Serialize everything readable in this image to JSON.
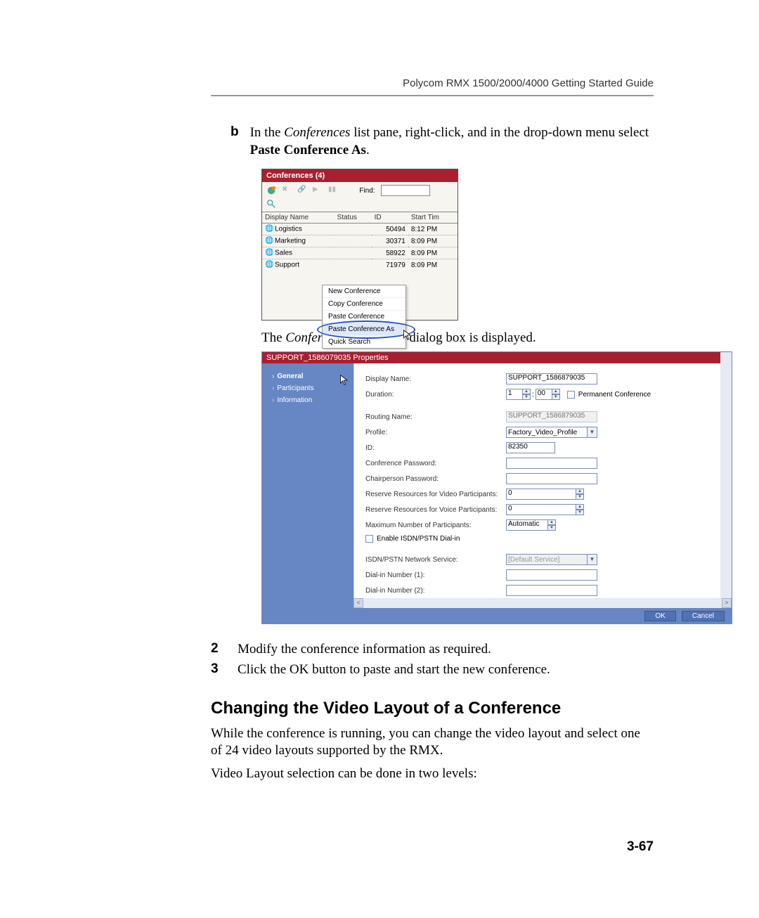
{
  "header": {
    "title": "Polycom RMX 1500/2000/4000 Getting Started Guide"
  },
  "stepB": {
    "label": "b",
    "prefix": "In the ",
    "italic1": "Conferences",
    "mid": " list pane, right-click, and in the drop-down menu select ",
    "bold1": "Paste Conference As",
    "suffix": "."
  },
  "conferences": {
    "title": "Conferences (4)",
    "find_label": "Find:",
    "cols": [
      "Display Name",
      "Status",
      "ID",
      "Start Tim"
    ],
    "rows": [
      {
        "name": "Logistics",
        "status": "",
        "id": "50494",
        "time": "8:12 PM"
      },
      {
        "name": "Marketing",
        "status": "",
        "id": "30371",
        "time": "8:09 PM"
      },
      {
        "name": "Sales",
        "status": "",
        "id": "58922",
        "time": "8:09 PM"
      },
      {
        "name": "Support",
        "status": "",
        "id": "71979",
        "time": "8:09 PM"
      }
    ],
    "context_menu": [
      "New Conference",
      "Copy Conference",
      "Paste Conference",
      "Paste Conference As",
      "Quick Search"
    ]
  },
  "caption": {
    "prefix": "The ",
    "italic": "Conference Properties",
    "suffix": " dialog box is displayed."
  },
  "props": {
    "title": "SUPPORT_1586079035 Properties",
    "close": "×",
    "nav": [
      "General",
      "Participants",
      "Information"
    ],
    "labels": {
      "display_name": "Display Name:",
      "duration": "Duration:",
      "permanent": "Permanent Conference",
      "routing_name": "Routing Name:",
      "profile": "Profile:",
      "id": "ID:",
      "conf_pw": "Conference Password:",
      "chair_pw": "Chairperson Password:",
      "res_video": "Reserve Resources for Video Participants:",
      "res_voice": "Reserve Resources for Voice Participants:",
      "max_part": "Maximum Number of Participants:",
      "enable_isdn": "Enable ISDN/PSTN Dial-in",
      "isdn_service": "ISDN/PSTN Network Service:",
      "dialin1": "Dial-in Number (1):",
      "dialin2": "Dial-in Number (2):"
    },
    "values": {
      "display_name": "SUPPORT_1586879035",
      "duration_h": "1",
      "duration_sep": ":",
      "duration_m": "00",
      "routing_name": "SUPPORT_1586879035",
      "profile": "Factory_Video_Profile",
      "id": "82350",
      "res_video": "0",
      "res_voice": "0",
      "max_part": "Automatic",
      "isdn_service": "[Default Service]"
    },
    "buttons": {
      "ok": "OK",
      "cancel": "Cancel"
    }
  },
  "step2": {
    "num": "2",
    "text": "Modify the conference information as required."
  },
  "step3": {
    "num": "3",
    "text": "Click the OK button to paste and start the new conference."
  },
  "section": {
    "title": "Changing the Video Layout of a Conference",
    "para1": "While the conference is running, you can change the video layout and select one of 24 video layouts supported by the RMX.",
    "para2": "Video Layout selection can be done in two levels:"
  },
  "page_num": "3-67"
}
